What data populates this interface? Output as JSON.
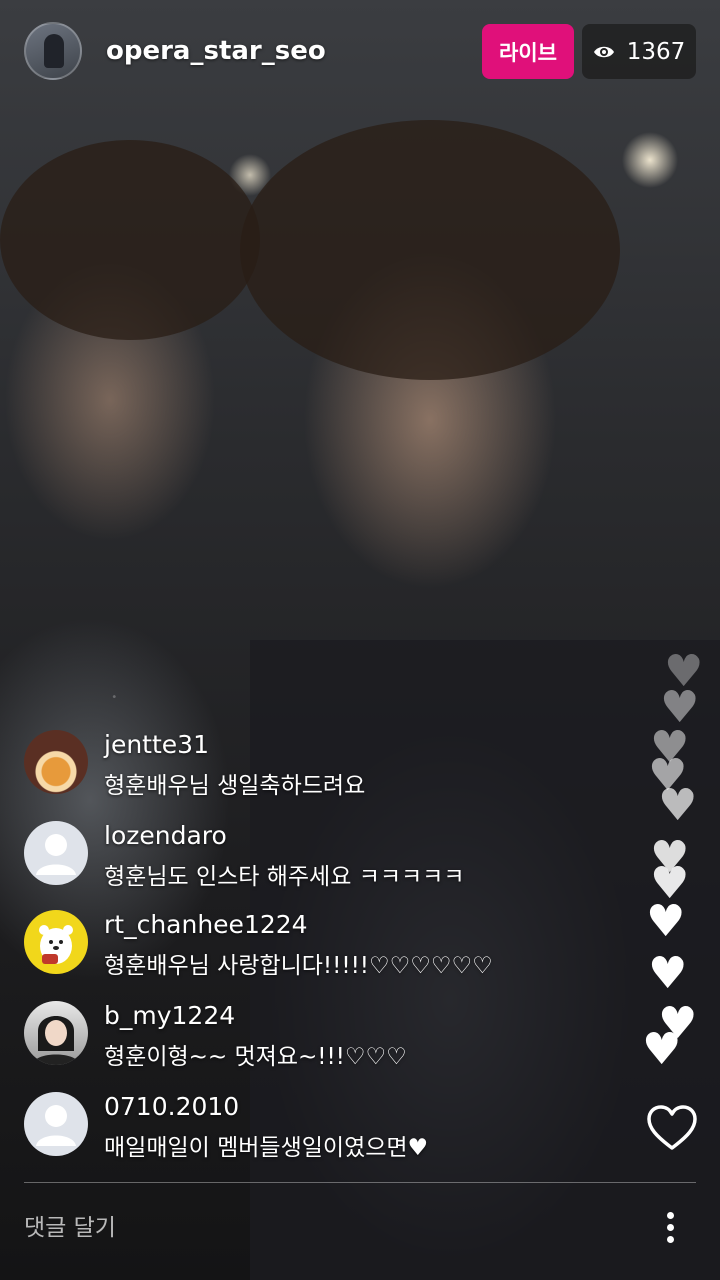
{
  "header": {
    "host_username": "opera_star_seo",
    "live_label": "라이브",
    "viewer_count": "1367"
  },
  "comments": [
    {
      "username": "jentte31",
      "text": "형훈배우님 생일축하드려요",
      "avatar": "teacup-avatar"
    },
    {
      "username": "lozendaro",
      "text": "형훈님도 인스타 해주세요 ㅋㅋㅋㅋㅋ",
      "avatar": "default-avatar"
    },
    {
      "username": "rt_chanhee1224",
      "text": "형훈배우님 사랑합니다!!!!!♡♡♡♡♡♡",
      "avatar": "polar-bear-avatar"
    },
    {
      "username": "b_my1224",
      "text": "형훈이형~~ 멋져요~!!!♡♡♡",
      "avatar": "profile-photo-avatar"
    },
    {
      "username": "0710.2010",
      "text": "매일매일이 멤버들생일이였으면♥",
      "avatar": "default-avatar"
    }
  ],
  "footer": {
    "comment_placeholder": "댓글 달기"
  },
  "colors": {
    "live_badge": "#e0107a",
    "default_avatar_bg": "#dfe3ea"
  },
  "icons": [
    "eye-icon",
    "heart-outline-icon",
    "more-vertical-icon",
    "floating-heart-icon"
  ]
}
